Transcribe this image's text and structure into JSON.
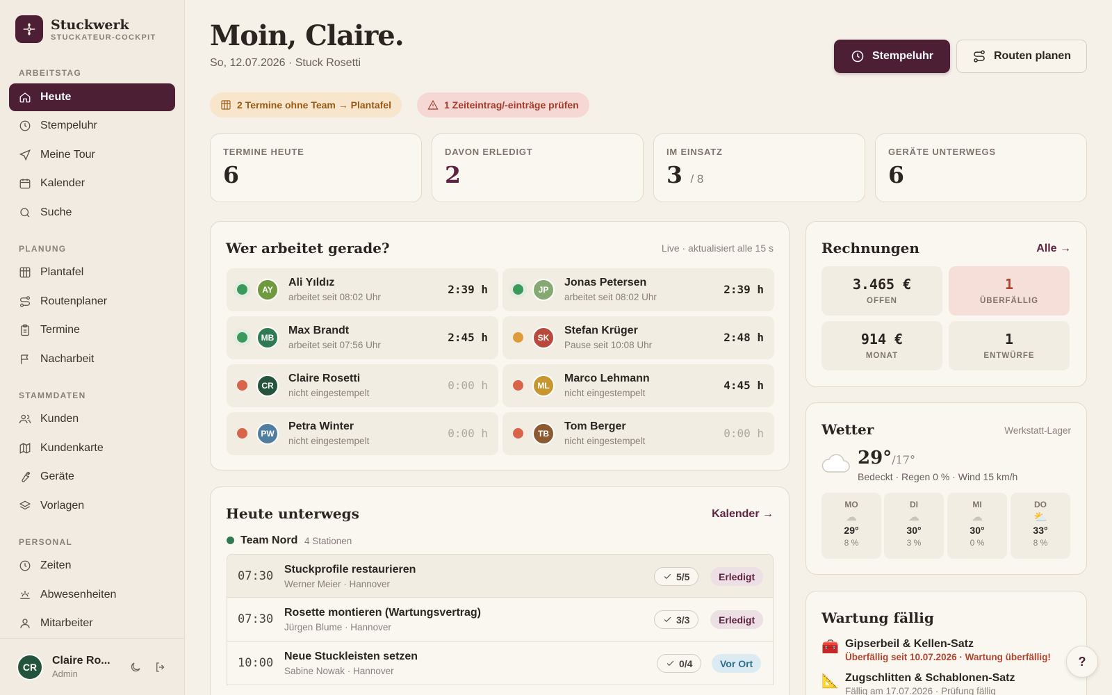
{
  "brand": {
    "name": "Stuckwerk",
    "subtitle": "STUCKATEUR-COCKPIT"
  },
  "sidebar": {
    "sections": [
      {
        "label": "ARBEITSTAG"
      },
      {
        "label": "PLANUNG"
      },
      {
        "label": "STAMMDATEN"
      },
      {
        "label": "PERSONAL"
      }
    ],
    "items": [
      {
        "label": "Heute",
        "icon": "home-icon",
        "active": true
      },
      {
        "label": "Stempeluhr",
        "icon": "clock-icon"
      },
      {
        "label": "Meine Tour",
        "icon": "navigation-icon"
      },
      {
        "label": "Kalender",
        "icon": "calendar-icon"
      },
      {
        "label": "Suche",
        "icon": "search-icon"
      },
      {
        "label": "Plantafel",
        "icon": "board-icon"
      },
      {
        "label": "Routenplaner",
        "icon": "route-icon"
      },
      {
        "label": "Termine",
        "icon": "clipboard-icon"
      },
      {
        "label": "Nacharbeit",
        "icon": "flag-icon"
      },
      {
        "label": "Kunden",
        "icon": "users-icon"
      },
      {
        "label": "Kundenkarte",
        "icon": "map-icon"
      },
      {
        "label": "Geräte",
        "icon": "wrench-icon"
      },
      {
        "label": "Vorlagen",
        "icon": "layers-icon"
      },
      {
        "label": "Zeiten",
        "icon": "clock-icon"
      },
      {
        "label": "Abwesenheiten",
        "icon": "sunset-icon"
      },
      {
        "label": "Mitarbeiter",
        "icon": "user-icon"
      }
    ]
  },
  "user": {
    "initials": "CR",
    "name": "Claire Ro...",
    "role": "Admin"
  },
  "header": {
    "greeting": "Moin, Claire.",
    "subline": "So, 12.07.2026 · Stuck Rosetti",
    "primary_button": "Stempeluhr",
    "secondary_button": "Routen planen"
  },
  "alerts": [
    {
      "text": "2 Termine ohne Team → Plantafel"
    },
    {
      "text": "1 Zeiteintrag/-einträge prüfen"
    }
  ],
  "stats": [
    {
      "label": "TERMINE HEUTE",
      "value": "6"
    },
    {
      "label": "DAVON ERLEDIGT",
      "value": "2",
      "color": "#5e2340"
    },
    {
      "label": "IM EINSATZ",
      "value": "3",
      "suffix": "/ 8"
    },
    {
      "label": "GERÄTE UNTERWEGS",
      "value": "6"
    }
  ],
  "workers_card": {
    "title": "Wer arbeitet gerade?",
    "meta": "Live · aktualisiert alle 15 s",
    "workers": [
      {
        "initials": "AY",
        "name": "Ali Yıldız",
        "status": "arbeitet seit 08:02 Uhr",
        "time": "2:39 h",
        "dot": "#3a9a5c",
        "avatar": "#6f9a3e",
        "active": true
      },
      {
        "initials": "JP",
        "name": "Jonas Petersen",
        "status": "arbeitet seit 08:02 Uhr",
        "time": "2:39 h",
        "dot": "#3a9a5c",
        "avatar": "#86a872",
        "active": true
      },
      {
        "initials": "MB",
        "name": "Max Brandt",
        "status": "arbeitet seit 07:56 Uhr",
        "time": "2:45 h",
        "dot": "#3a9a5c",
        "avatar": "#2f7a52",
        "active": true
      },
      {
        "initials": "SK",
        "name": "Stefan Krüger",
        "status": "Pause seit 10:08 Uhr",
        "time": "2:48 h",
        "dot": "#e09a3a",
        "avatar": "#b84a3c",
        "active": true
      },
      {
        "initials": "CR",
        "name": "Claire Rosetti",
        "status": "nicht eingestempelt",
        "time": "0:00 h",
        "dot": "#d8654a",
        "avatar": "#24543c",
        "active": false
      },
      {
        "initials": "ML",
        "name": "Marco Lehmann",
        "status": "nicht eingestempelt",
        "time": "4:45 h",
        "dot": "#d8654a",
        "avatar": "#c8962e",
        "active": false
      },
      {
        "initials": "PW",
        "name": "Petra Winter",
        "status": "nicht eingestempelt",
        "time": "0:00 h",
        "dot": "#d8654a",
        "avatar": "#4f7ea0",
        "active": false
      },
      {
        "initials": "TB",
        "name": "Tom Berger",
        "status": "nicht eingestempelt",
        "time": "0:00 h",
        "dot": "#d8654a",
        "avatar": "#8c5a2e",
        "active": false
      }
    ]
  },
  "invoices": {
    "title": "Rechnungen",
    "link": "Alle →",
    "tiles": [
      {
        "value": "3.465 €",
        "label": "OFFEN"
      },
      {
        "value": "1",
        "label": "ÜBERFÄLLIG",
        "alert": true
      },
      {
        "value": "914 €",
        "label": "MONAT"
      },
      {
        "value": "1",
        "label": "ENTWÜRFE"
      }
    ]
  },
  "weather": {
    "title": "Wetter",
    "location": "Werkstatt-Lager",
    "temp": "29°",
    "low": "/17°",
    "desc": "Bedeckt · Regen 0 % · Wind 15 km/h",
    "icon": "cloud-icon",
    "forecast": [
      {
        "day": "MO",
        "icon": "cloud-icon",
        "temp": "29°",
        "rain": "8 %"
      },
      {
        "day": "DI",
        "icon": "cloud-icon",
        "temp": "30°",
        "rain": "3 %"
      },
      {
        "day": "MI",
        "icon": "cloud-icon",
        "temp": "30°",
        "rain": "0 %"
      },
      {
        "day": "DO",
        "icon": "sun-cloud-icon",
        "temp": "33°",
        "rain": "8 %"
      }
    ]
  },
  "routes": {
    "title": "Heute unterwegs",
    "link": "Kalender →",
    "team": "Team Nord",
    "team_meta": "4 Stationen",
    "rows": [
      {
        "time": "07:30",
        "name": "Stuckprofile restaurieren",
        "sub": "Werner Meier · Hannover",
        "progress": "5/5",
        "status": "Erledigt",
        "status_type": "done"
      },
      {
        "time": "07:30",
        "name": "Rosette montieren (Wartungsvertrag)",
        "sub": "Jürgen Blume · Hannover",
        "progress": "3/3",
        "status": "Erledigt",
        "status_type": "done"
      },
      {
        "time": "10:00",
        "name": "Neue Stuckleisten setzen",
        "sub": "Sabine Nowak · Hannover",
        "progress": "0/4",
        "status": "Vor Ort",
        "status_type": "onsite"
      }
    ]
  },
  "maintenance": {
    "title": "Wartung fällig",
    "items": [
      {
        "name": "Gipserbeil & Kellen-Satz",
        "status": "Überfällig seit 10.07.2026 · Wartung überfällig!",
        "icon": "toolbox-icon",
        "overdue": true
      },
      {
        "name": "Zugschlitten & Schablonen-Satz",
        "status": "Fällig am 17.07.2026 · Prüfung fällig",
        "icon": "ruler-icon",
        "overdue": false
      }
    ]
  },
  "help_label": "?"
}
